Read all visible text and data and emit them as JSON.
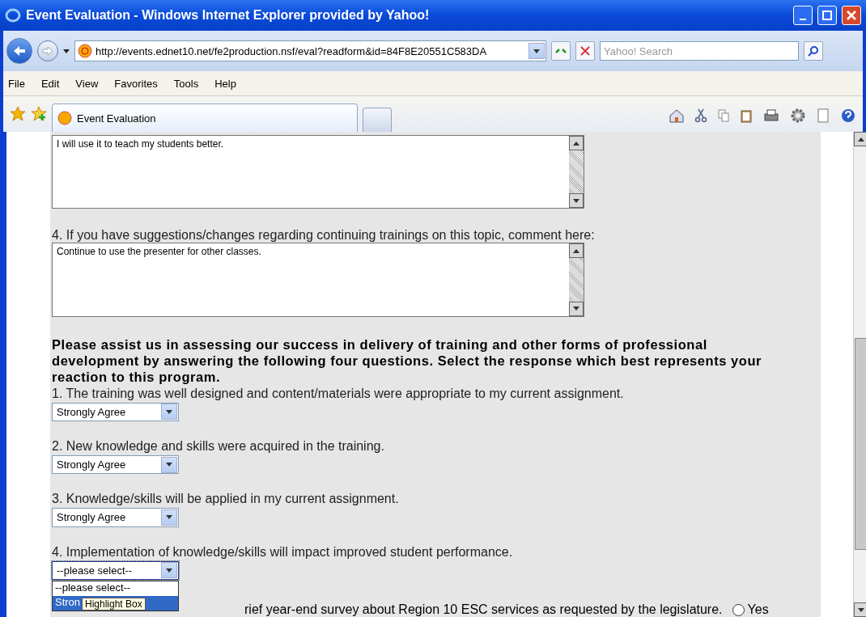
{
  "window": {
    "title": "Event Evaluation - Windows Internet Explorer provided by Yahoo!"
  },
  "address_bar": {
    "url": "http://events.ednet10.net/fe2production.nsf/eval?readform&id=84F8E20551C583DA"
  },
  "search": {
    "placeholder": "Yahoo! Search"
  },
  "menu": [
    "File",
    "Edit",
    "View",
    "Favorites",
    "Tools",
    "Help"
  ],
  "tabs": [
    {
      "label": "Event Evaluation",
      "selected": true
    }
  ],
  "open_questions": [
    {
      "value": "I will use it to teach my students better."
    },
    {
      "label": "4. If you have suggestions/changes regarding continuing trainings on this topic, comment here:",
      "value": "Continue to use the presenter for other classes."
    }
  ],
  "instructions": "Please assist us in assessing our success in delivery of training and other forms of professional development by answering the following four questions. Select the response which best represents your reaction to this program.",
  "rating_questions": [
    {
      "label": "1. The training was well designed and content/materials were appropriate to my current assignment.",
      "value": "Strongly Agree",
      "open": false
    },
    {
      "label": "2. New knowledge and skills were acquired in the training.",
      "value": "Strongly Agree",
      "open": false
    },
    {
      "label": "3. Knowledge/skills will be applied in my current assignment.",
      "value": "Strongly Agree",
      "open": false
    },
    {
      "label": "4. Implementation of knowledge/skills will impact improved student performance.",
      "value": "--please select--",
      "open": true,
      "options": [
        {
          "label": "--please select--",
          "highlighted": false
        },
        {
          "label": "Stron",
          "highlighted": true
        }
      ]
    }
  ],
  "tooltip": "Highlight Box",
  "survey": {
    "label": "rief year-end survey about Region 10 ESC services as requested by the legislature.",
    "options": [
      {
        "label": "Yes",
        "selected": false
      }
    ]
  }
}
